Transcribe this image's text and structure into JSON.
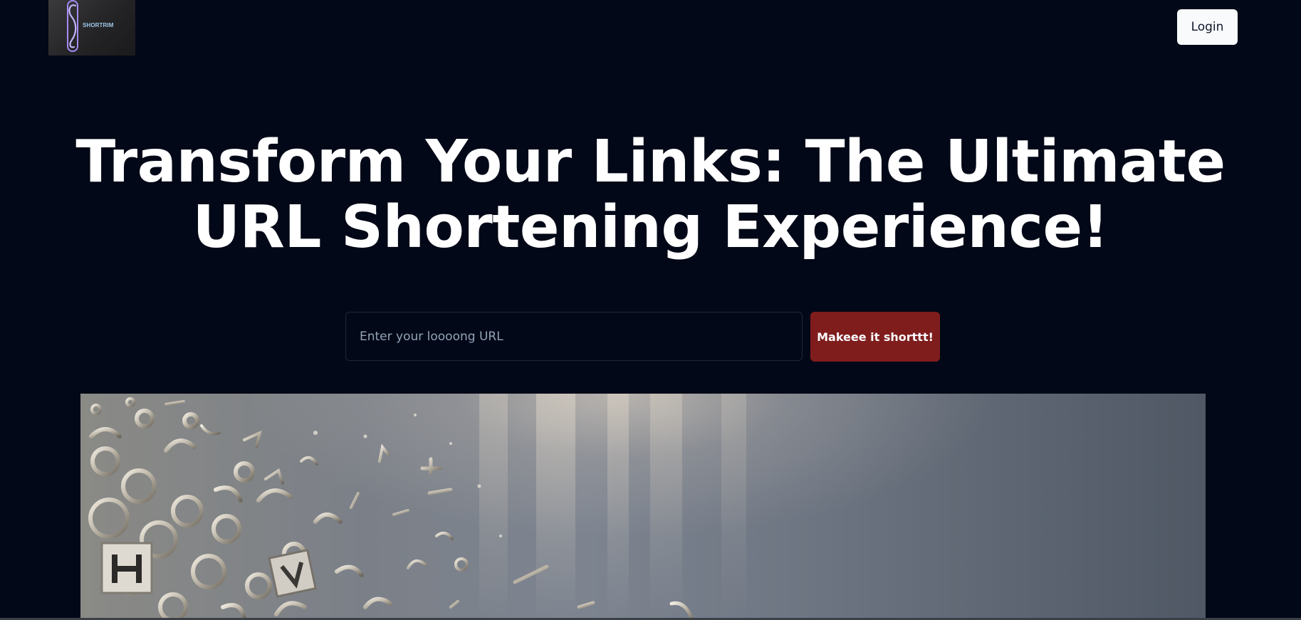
{
  "header": {
    "logo_letter": "S",
    "logo_text": "SHORTRIM",
    "login_label": "Login"
  },
  "hero": {
    "title_line1": "Transform Your Links: The Ultimate",
    "title_line2": "URL Shortening Experience!"
  },
  "form": {
    "url_placeholder": "Enter your loooong URL",
    "url_value": "",
    "submit_label": "Makeee it shorttt!"
  },
  "colors": {
    "background": "#020817",
    "primary_button": "#7f1d1d",
    "login_button": "#f8fafc"
  }
}
